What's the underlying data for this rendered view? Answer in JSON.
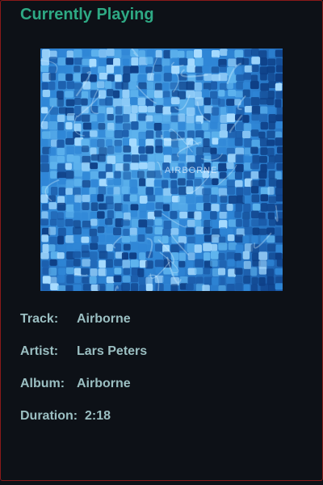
{
  "header": {
    "title": "Currently Playing"
  },
  "album_art": {
    "text": "AIRBORNE",
    "colors": [
      "#1a5aa8",
      "#2f86d6",
      "#5fb4ee",
      "#a8dcff",
      "#0e3f86"
    ]
  },
  "track_info": {
    "track_label": "Track:",
    "track_value": "Airborne",
    "artist_label": "Artist:",
    "artist_value": "Lars Peters",
    "album_label": "Album:",
    "album_value": "Airborne",
    "duration_label": "Duration:",
    "duration_value": "2:18"
  },
  "colors": {
    "background": "#0d1117",
    "border": "#8b1a1a",
    "title": "#2ea984",
    "text": "#9bbfc2"
  }
}
